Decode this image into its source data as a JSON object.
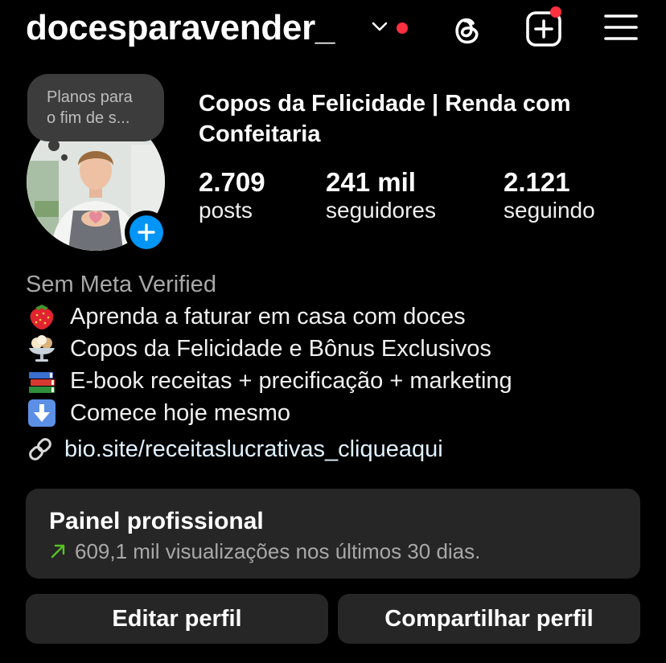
{
  "header": {
    "username": "docesparavender_",
    "accent_dot_color": "#ff3040"
  },
  "note": {
    "lines": [
      "Planos para",
      "o fim de s..."
    ]
  },
  "profile": {
    "name": "Copos da Felicidade | Renda com Confeitaria",
    "stats": [
      {
        "value": "2.709",
        "label": "posts"
      },
      {
        "value": "241 mil",
        "label": "seguidores"
      },
      {
        "value": "2.121",
        "label": "seguindo"
      }
    ]
  },
  "bio": {
    "category": "Sem Meta Verified",
    "lines": [
      {
        "icon": "strawberry-icon",
        "text": "Aprenda a faturar em casa com doces"
      },
      {
        "icon": "ice-cream-cup-icon",
        "text": "Copos da Felicidade e Bônus Exclusivos"
      },
      {
        "icon": "books-icon",
        "text": "E-book receitas + precificação + marketing"
      },
      {
        "icon": "down-arrow-icon",
        "text": "Comece hoje mesmo"
      }
    ],
    "link": "bio.site/receitaslucrativas_cliqueaqui"
  },
  "dashboard": {
    "title": "Painel profissional",
    "subtitle": "609,1 mil visualizações nos últimos 30 dias."
  },
  "buttons": {
    "edit": "Editar perfil",
    "share": "Compartilhar perfil"
  },
  "colors": {
    "background": "#000000",
    "card": "#262626",
    "accent_blue": "#0095f6",
    "trend_green": "#58c322"
  }
}
